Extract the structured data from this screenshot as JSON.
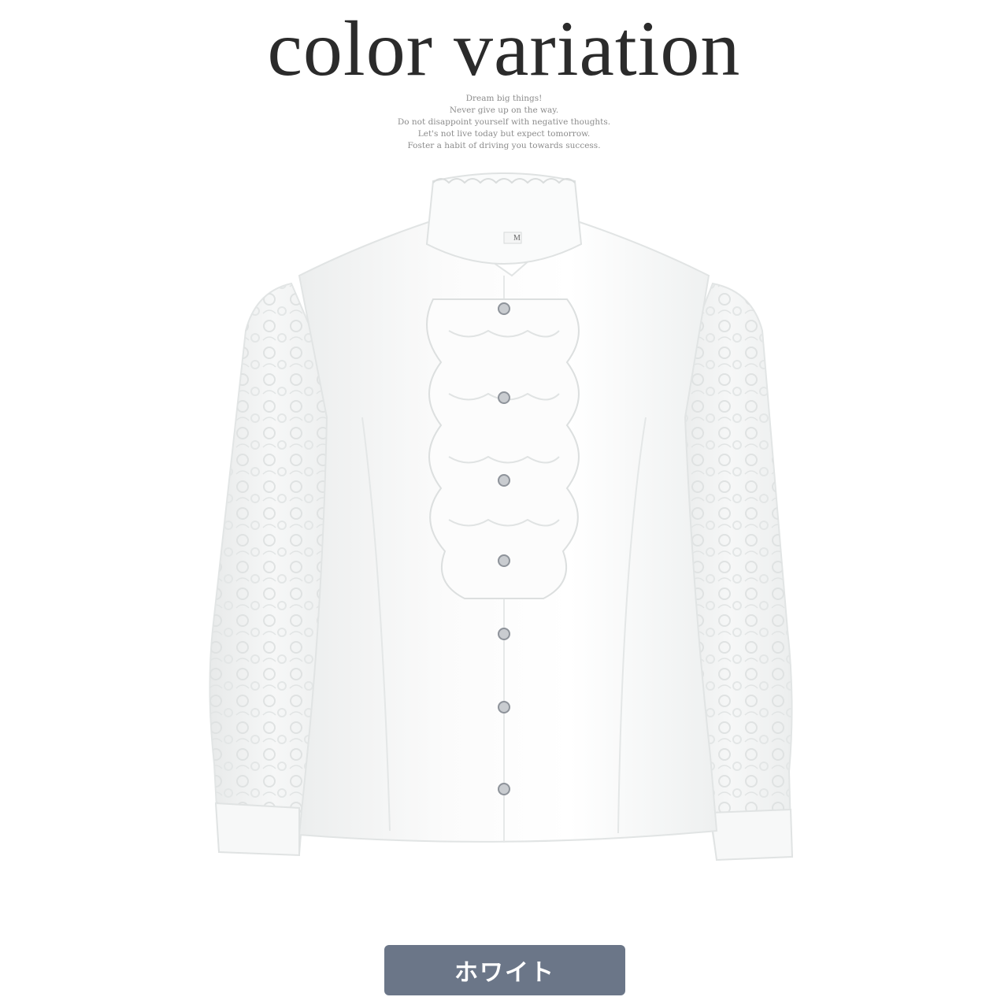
{
  "header": {
    "title": "color variation",
    "tagline": [
      "Dream big things!",
      "Never give up on the way.",
      "Do not disappoint yourself with negative thoughts.",
      "Let's not live today but expect tomorrow.",
      "Foster a habit of driving you towards success."
    ]
  },
  "product": {
    "image": "white-frill-lace-sleeve-blouse",
    "size_tag": "M",
    "color": "#ffffff"
  },
  "variant": {
    "label": "ホワイト",
    "badge_color": "#6b7688"
  }
}
